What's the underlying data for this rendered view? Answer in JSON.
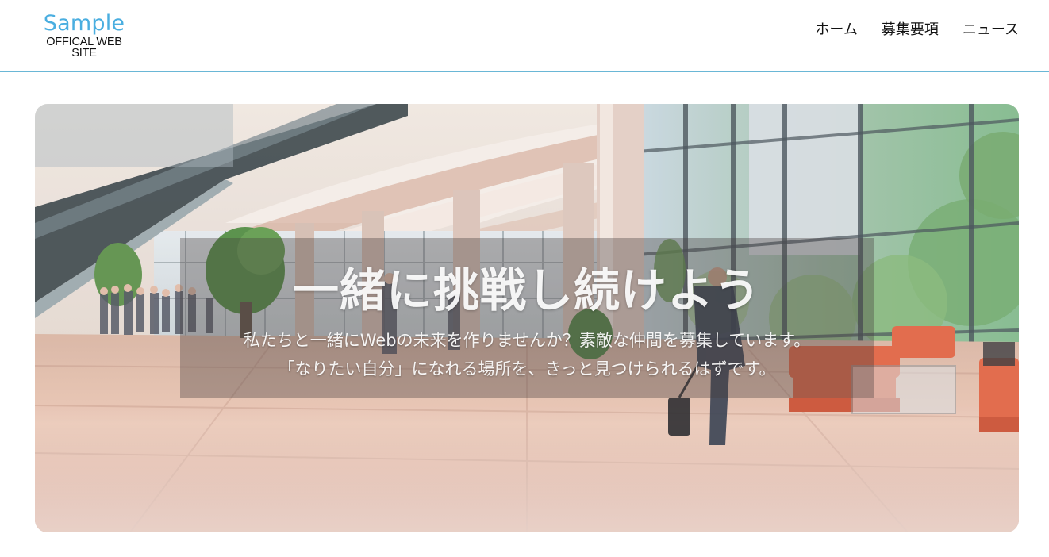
{
  "header": {
    "logo_title": "Sample",
    "logo_subtitle": "OFFICAL WEB SITE",
    "nav": [
      {
        "label": "ホーム"
      },
      {
        "label": "募集要項"
      },
      {
        "label": "ニュース"
      }
    ],
    "accent_color": "#4aaee0",
    "divider_color": "#6ab7d6"
  },
  "hero": {
    "title": "一緒に挑戦し続けよう",
    "subtitle_line1": "私たちと一緒にWebの未来を作りませんか？素敵な仲間を募集しています。",
    "subtitle_line2": "「なりたい自分」になれる場所を、きっと見つけられるはずです。",
    "background_image": "office lobby with escalator, glass windows, plants, orange sofas and people walking"
  }
}
